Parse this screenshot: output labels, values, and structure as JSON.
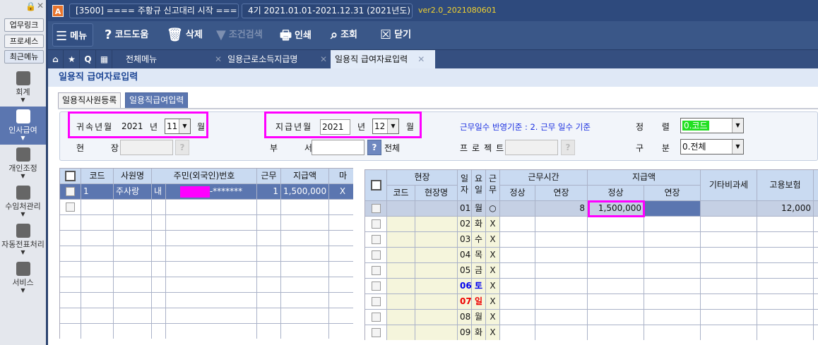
{
  "sidebar": {
    "buttons": [
      "업무링크",
      "프로세스",
      "최근메뉴"
    ],
    "items": [
      {
        "label": "회계",
        "active": false
      },
      {
        "label": "인사급여",
        "active": true
      },
      {
        "label": "개인조정",
        "active": false
      },
      {
        "label": "수임처관리",
        "active": false
      },
      {
        "label": "자동전표처리",
        "active": false
      },
      {
        "label": "서비스",
        "active": false
      }
    ]
  },
  "topbar": {
    "app_icon": "A",
    "company": "[3500] ==== 주황규 신고대리 시작 ===",
    "period": "4기 2021.01.01-2021.12.31",
    "year": "(2021년도)",
    "version": "ver2.0_2021080601"
  },
  "toolbar": {
    "menu": "메뉴",
    "code_help": "코드도움",
    "delete": "삭제",
    "filter": "조건검색",
    "print": "인쇄",
    "search": "조회",
    "close": "닫기"
  },
  "tabs": {
    "all_menu": "전체메뉴",
    "items": [
      {
        "label": "일용근로소득지급명",
        "active": false
      },
      {
        "label": "일용직 급여자료입력",
        "active": true
      }
    ]
  },
  "page": {
    "title": "일용직 급여자료입력",
    "subtabs": [
      {
        "label": "일용직사원등록",
        "active": false
      },
      {
        "label": "일용직급여입력",
        "active": true
      }
    ]
  },
  "filter": {
    "belong_label": "귀속년월",
    "belong_year": "2021",
    "year_unit": "년",
    "belong_month": "11",
    "month_unit": "월",
    "pay_label": "지급년월",
    "pay_year": "2021",
    "pay_month": "12",
    "criteria": "근무일수 반영기준 : 2. 근무 일수 기준",
    "sort_label": "정 렬",
    "sort_value": "0.코드",
    "site_label": "현 장",
    "site_value": "",
    "dept_label": "부 서",
    "dept_value": "",
    "dept_all": "전체",
    "project_label": "프로젝트",
    "project_value": "",
    "div_label": "구 분",
    "div_value": "0.전체",
    "help": "?"
  },
  "left_grid": {
    "headers": [
      "코드",
      "사원명",
      "주민(외국인)번호",
      "근무",
      "지급액",
      "마"
    ],
    "rows": [
      {
        "code": "1",
        "name": "주사랑",
        "type": "내",
        "rrn": "-*******",
        "days": "1",
        "amount": "1,500,000",
        "mark": "X"
      }
    ]
  },
  "right_grid": {
    "headers": {
      "site": "현장",
      "site_code": "코드",
      "site_name": "현장명",
      "day": "일자",
      "weekday": "요일",
      "work": "근무",
      "hours": "근무시간",
      "normal": "정상",
      "overtime": "연장",
      "pay": "지급액",
      "pay_normal": "정상",
      "pay_overtime": "연장",
      "other": "기타비과세",
      "insurance": "고용보험"
    },
    "rows": [
      {
        "day": "01",
        "wd": "월",
        "work": "○",
        "normal": "",
        "overtime": "8",
        "pay_normal": "1,500,000",
        "pay_overtime": "",
        "other": "",
        "insurance": "12,000"
      },
      {
        "day": "02",
        "wd": "화",
        "work": "X"
      },
      {
        "day": "03",
        "wd": "수",
        "work": "X"
      },
      {
        "day": "04",
        "wd": "목",
        "work": "X"
      },
      {
        "day": "05",
        "wd": "금",
        "work": "X"
      },
      {
        "day": "06",
        "wd": "토",
        "work": "X",
        "color": "#0000ee"
      },
      {
        "day": "07",
        "wd": "일",
        "work": "X",
        "color": "#ee0000"
      },
      {
        "day": "08",
        "wd": "월",
        "work": "X"
      },
      {
        "day": "09",
        "wd": "화",
        "work": "X"
      }
    ]
  },
  "colors": {
    "accent": "#5b76b0",
    "highlight": "#ff00ff",
    "header": "#c9daf1",
    "site_bg": "#f5f5dc"
  }
}
